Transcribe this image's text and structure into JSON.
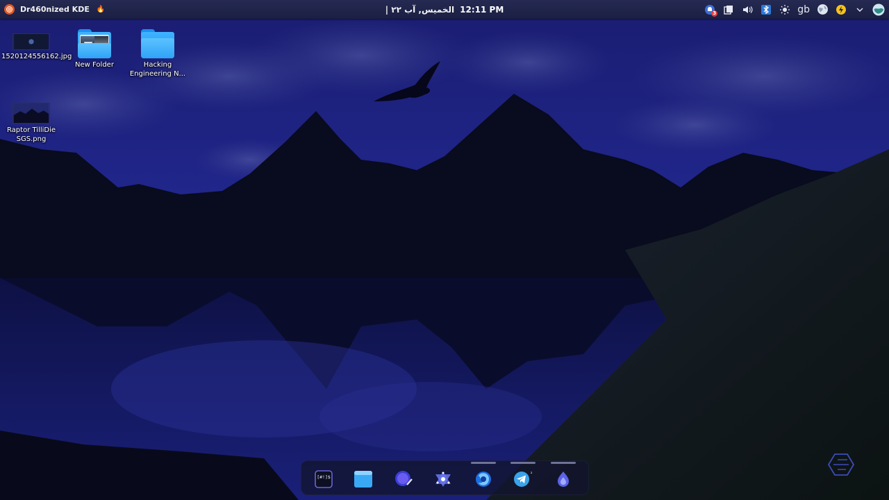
{
  "panel": {
    "menu_label": "Dr460nized KDE",
    "clock": {
      "time": "12:11 PM",
      "date": "الخميس, آب ٢٢ |"
    },
    "tray": {
      "notification_count": "3",
      "keyboard_layout": "gb"
    }
  },
  "desktop": {
    "icons": [
      {
        "label": "1520124556162.jpg",
        "kind": "image"
      },
      {
        "label": "New Folder",
        "kind": "folder"
      },
      {
        "label": "Hacking Engineering N...",
        "kind": "folder"
      },
      {
        "label": "Raptor TilliDie SGS.png",
        "kind": "image"
      }
    ]
  },
  "dock": {
    "items": [
      {
        "name": "terminal",
        "glyph": "[#!]$",
        "running": false
      },
      {
        "name": "file-manager",
        "running": false
      },
      {
        "name": "browser-app",
        "running": false
      },
      {
        "name": "kde-connect",
        "running": false
      },
      {
        "name": "firefox",
        "running": true
      },
      {
        "name": "telegram",
        "glyph": "²",
        "running": true
      },
      {
        "name": "garuda-app",
        "running": true
      }
    ]
  },
  "colors": {
    "panel": "#1f2347",
    "sky": "#1a1f7a",
    "accent": "#2c9bf6"
  }
}
